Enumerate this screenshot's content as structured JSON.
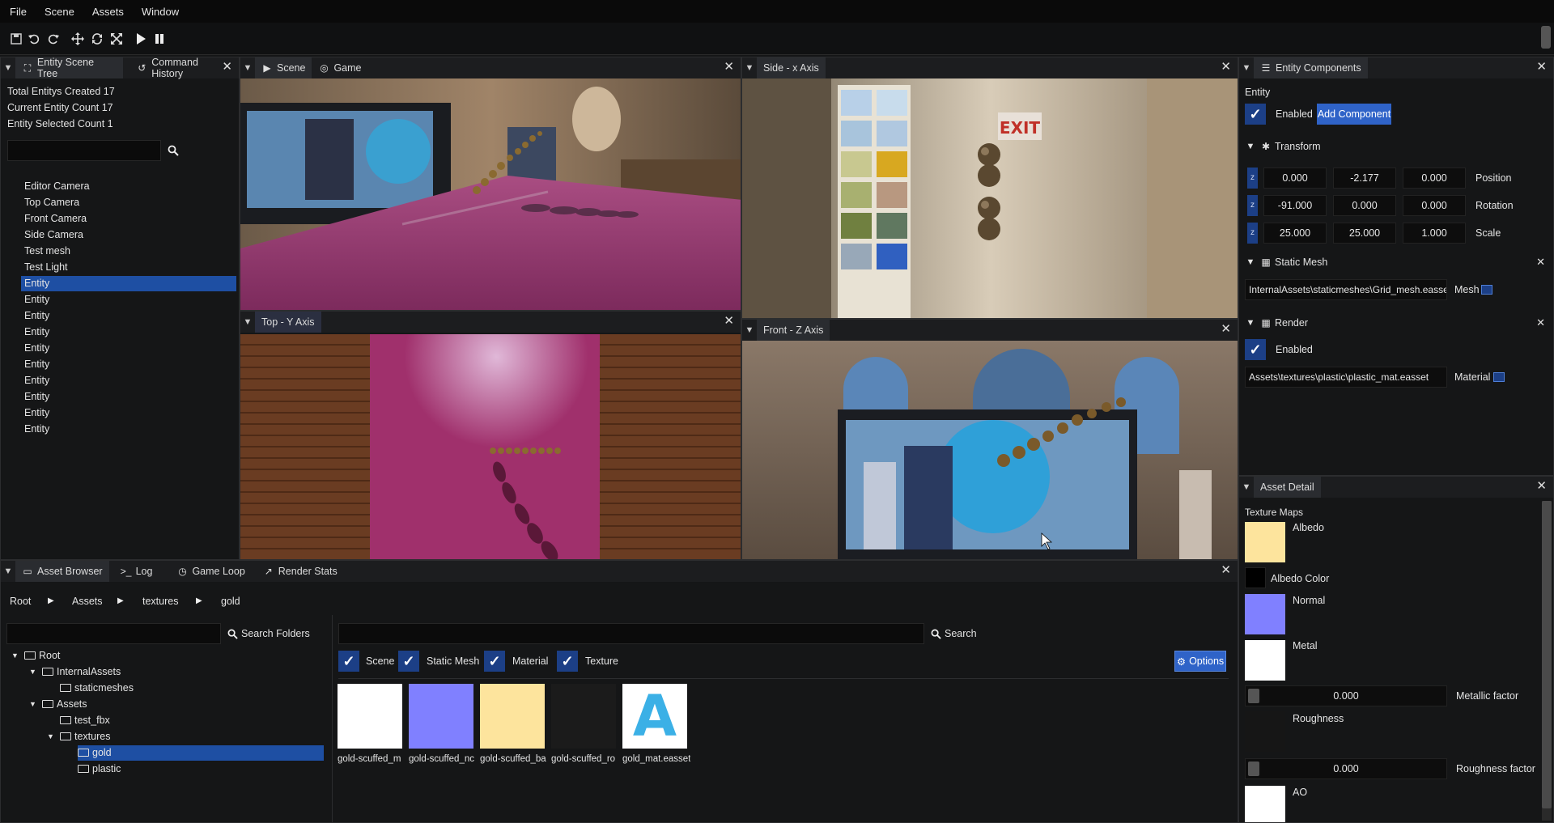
{
  "menu": [
    "File",
    "Scene",
    "Assets",
    "Window"
  ],
  "toolbar_icons": [
    "save-icon",
    "undo-icon",
    "redo-icon",
    "move-icon",
    "rotate-icon",
    "scale-icon",
    "play-icon",
    "pause-icon"
  ],
  "scene_tree": {
    "tabs": [
      "Entity Scene Tree",
      "Command History"
    ],
    "stats": [
      "Total Entitys Created 17",
      "Current Entity Count 17",
      "Entity Selected Count 1"
    ],
    "search_value": "",
    "items": [
      "Editor Camera",
      "Top Camera",
      "Front Camera",
      "Side Camera",
      "Test mesh",
      "Test Light",
      "Entity",
      "Entity",
      "Entity",
      "Entity",
      "Entity",
      "Entity",
      "Entity",
      "Entity",
      "Entity",
      "Entity"
    ],
    "selected_index": 6
  },
  "viewports": {
    "scene_tabs": [
      "Scene",
      "Game"
    ],
    "side": "Side - x Axis",
    "top": "Top - Y Axis",
    "front": "Front - Z Axis",
    "exit_sign": "EXIT"
  },
  "components": {
    "tab": "Entity Components",
    "entity_label": "Entity",
    "enabled_label": "Enabled",
    "add_component": "Add Component",
    "transform": {
      "title": "Transform",
      "axis_badge": "z",
      "rows": [
        {
          "values": [
            "0.000",
            "-2.177",
            "0.000"
          ],
          "label": "Position"
        },
        {
          "values": [
            "-91.000",
            "0.000",
            "0.000"
          ],
          "label": "Rotation"
        },
        {
          "values": [
            "25.000",
            "25.000",
            "1.000"
          ],
          "label": "Scale"
        }
      ]
    },
    "static_mesh": {
      "title": "Static Mesh",
      "path": "InternalAssets\\staticmeshes\\Grid_mesh.easset",
      "label": "Mesh"
    },
    "render": {
      "title": "Render",
      "enabled_label": "Enabled",
      "path": "Assets\\textures\\plastic\\plastic_mat.easset",
      "label": "Material"
    }
  },
  "asset_detail": {
    "tab": "Asset Detail",
    "heading": "Texture Maps",
    "albedo": "Albedo",
    "albedo_color": "Albedo Color",
    "normal": "Normal",
    "metal": "Metal",
    "metallic_factor": {
      "value": "0.000",
      "label": "Metallic factor"
    },
    "roughness": "Roughness",
    "roughness_factor": {
      "value": "0.000",
      "label": "Roughness factor"
    },
    "ao": "AO",
    "colors": {
      "albedo": "#fde49d",
      "albedo_color": "#000000",
      "normal": "#8080ff",
      "metal": "#ffffff",
      "ao": "#ffffff"
    }
  },
  "asset_browser": {
    "tabs": [
      "Asset Browser",
      "Log",
      "Game Loop",
      "Render Stats"
    ],
    "breadcrumb": [
      "Root",
      "Assets",
      "textures",
      "gold"
    ],
    "folder_search_value": "",
    "search_folders": "Search Folders",
    "search_value": "",
    "search": "Search",
    "filters": [
      "Scene",
      "Static Mesh",
      "Material",
      "Texture"
    ],
    "options": "Options",
    "folders": [
      {
        "name": "Root",
        "depth": 0,
        "arrow": true
      },
      {
        "name": "InternalAssets",
        "depth": 1,
        "arrow": true
      },
      {
        "name": "staticmeshes",
        "depth": 2,
        "arrow": false
      },
      {
        "name": "Assets",
        "depth": 1,
        "arrow": true
      },
      {
        "name": "test_fbx",
        "depth": 2,
        "arrow": false
      },
      {
        "name": "textures",
        "depth": 2,
        "arrow": true
      },
      {
        "name": "gold",
        "depth": 3,
        "arrow": false,
        "selected": true
      },
      {
        "name": "plastic",
        "depth": 3,
        "arrow": false
      }
    ],
    "assets": [
      {
        "label": "gold-scuffed_m",
        "color": "#ffffff"
      },
      {
        "label": "gold-scuffed_nc",
        "color": "#8080ff"
      },
      {
        "label": "gold-scuffed_ba",
        "color": "#fde49d"
      },
      {
        "label": "gold-scuffed_ro",
        "color": "#1b1b1b"
      },
      {
        "label": "gold_mat.easset",
        "color": "#ffffff",
        "glyph": "A",
        "glyph_color": "#3bb0e6"
      }
    ]
  }
}
